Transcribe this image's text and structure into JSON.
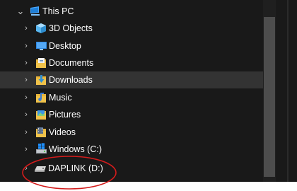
{
  "tree": {
    "root": {
      "label": "This PC",
      "expanded_glyph": "⌄",
      "icon": "this-pc-icon"
    },
    "collapsed_glyph": "›",
    "items": [
      {
        "label": "3D Objects",
        "icon": "3d-objects-icon"
      },
      {
        "label": "Desktop",
        "icon": "desktop-icon"
      },
      {
        "label": "Documents",
        "icon": "documents-icon"
      },
      {
        "label": "Downloads",
        "icon": "downloads-icon",
        "selected": true
      },
      {
        "label": "Music",
        "icon": "music-icon"
      },
      {
        "label": "Pictures",
        "icon": "pictures-icon"
      },
      {
        "label": "Videos",
        "icon": "videos-icon"
      },
      {
        "label": "Windows (C:)",
        "icon": "windows-drive-icon"
      },
      {
        "label": "DAPLINK (D:)",
        "icon": "usb-drive-icon"
      }
    ]
  },
  "colors": {
    "pane_background": "#191919",
    "selected_row": "#333333",
    "text": "#ffffff",
    "annotation_circle": "#d41c1c"
  },
  "annotation": {
    "shape": "ellipse",
    "target": "DAPLINK (D:)"
  }
}
